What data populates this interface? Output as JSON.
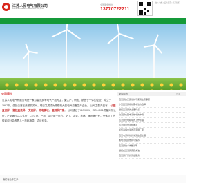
{
  "header": {
    "company_name": "江苏人民电气有限公司",
    "company_name_en": "JIANGSU RENMIN ELECTRIC CO.,LTD",
    "phone_label": "全国服务热线",
    "phone": "13770722211",
    "top_links": "加入收藏 | 设为首页 | 联系我们"
  },
  "nav": [
    "网站首页",
    "关于我们",
    "产品展示",
    "新闻中心",
    "资质荣誉",
    "客户案例",
    "在线留言",
    "联系我们"
  ],
  "intro": {
    "title": "公司简介",
    "paragraph1": "江苏人民电气有限公司是一家以直流屏等电气产品为主，集生产、研发、销售于一体的企业，成立于1997年，总部坐落在美丽的苏州，现已发展成为规模较大的电气设备生产企业。",
    "highlight_prefix": "公司主要产品有：",
    "highlights": [
      "小型直流屏",
      "壁挂直流屏",
      "交流屏",
      "充电模块",
      "直流屏厂家"
    ],
    "paragraph2": "公司通过了ISO9001、ISO14001质量体系认证，产品通过CCC认证，CE认证。产品广泛应用于电力、化工、冶金、铁路、通讯等行业。全体员工热忱欢迎社会各界人士莅临指导，洽谈业务。",
    "footer_note": "我们专业于生产："
  },
  "news": {
    "title": "新闻动态",
    "more": "更多",
    "items": [
      "直流屏的安装维护与使用注意事项",
      "小型直流屏系统蓄电池的选择",
      "壁挂直流屏的主要特点",
      "交流屏在配电系统中的作用",
      "直流屏充电模块的工作原理",
      "直流屏日常巡检要点",
      "如何选择合适的直流屏厂家",
      "直流电源系统的常见故障处理",
      "蓄电池组的维护与保养",
      "直流屏技术参数说明",
      "壁挂式直流屏安装方法",
      "直流屏厂家的售后服务"
    ]
  }
}
